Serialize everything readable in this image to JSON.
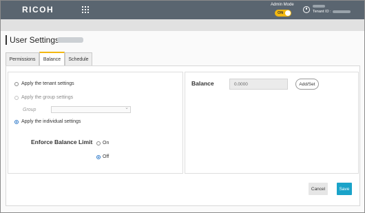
{
  "header": {
    "logo": "RICOH",
    "admin_mode_label": "Admin Mode",
    "admin_toggle_label": "ON",
    "tenant_label": "Tenant ID :"
  },
  "page": {
    "title": "User Settings:"
  },
  "tabs": [
    {
      "label": "Permissions",
      "active": false
    },
    {
      "label": "Balance",
      "active": true
    },
    {
      "label": "Schedule",
      "active": false
    }
  ],
  "settings": {
    "options": [
      {
        "label": "Apply the tenant settings",
        "checked": false,
        "disabled": false
      },
      {
        "label": "Apply the group settings",
        "checked": false,
        "disabled": true
      },
      {
        "label": "Apply the individual settings",
        "checked": true,
        "disabled": false
      }
    ],
    "group_label": "Group",
    "enforce_label": "Enforce Balance Limit",
    "enforce_on": "On",
    "enforce_off": "Off",
    "enforce_value": "Off"
  },
  "balance": {
    "label": "Balance",
    "value": "0.0000",
    "add_button": "Add/Set"
  },
  "footer": {
    "cancel": "Cancel",
    "save": "Save"
  },
  "colors": {
    "header_bg": "#5a6570",
    "accent": "#f2b811",
    "save_bg": "#1aa3c9"
  }
}
